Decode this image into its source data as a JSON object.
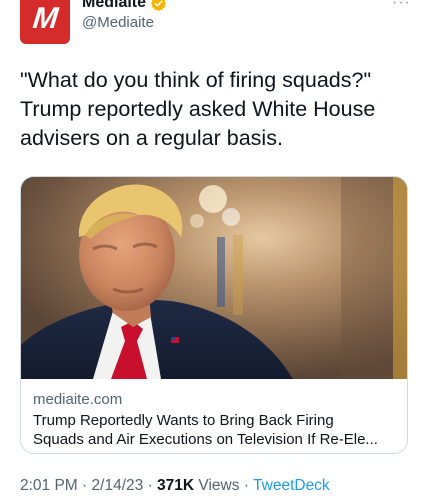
{
  "author": {
    "display_name": "Mediaite",
    "handle": "@Mediaite",
    "avatar_letter": "M",
    "avatar_color": "#d62b2b",
    "verified_color": "#f4b400"
  },
  "more_icon": "more-dots-icon",
  "tweet": {
    "text": "\"What do you think of firing squads?\"\nTrump reportedly asked White House\nadvisers on a regular basis."
  },
  "card": {
    "domain": "mediaite.com",
    "title": "Trump Reportedly Wants to Bring Back Firing\nSquads and Air Executions on Television If Re-Ele..."
  },
  "footer": {
    "time": "2:01 PM",
    "date": "2/14/23",
    "separator": "·",
    "views_count": "371K",
    "views_label": "Views",
    "source": "TweetDeck"
  },
  "colors": {
    "text_primary": "#0f1419",
    "text_secondary": "#536471",
    "link": "#1d9bf0",
    "border": "#cfd9de"
  }
}
